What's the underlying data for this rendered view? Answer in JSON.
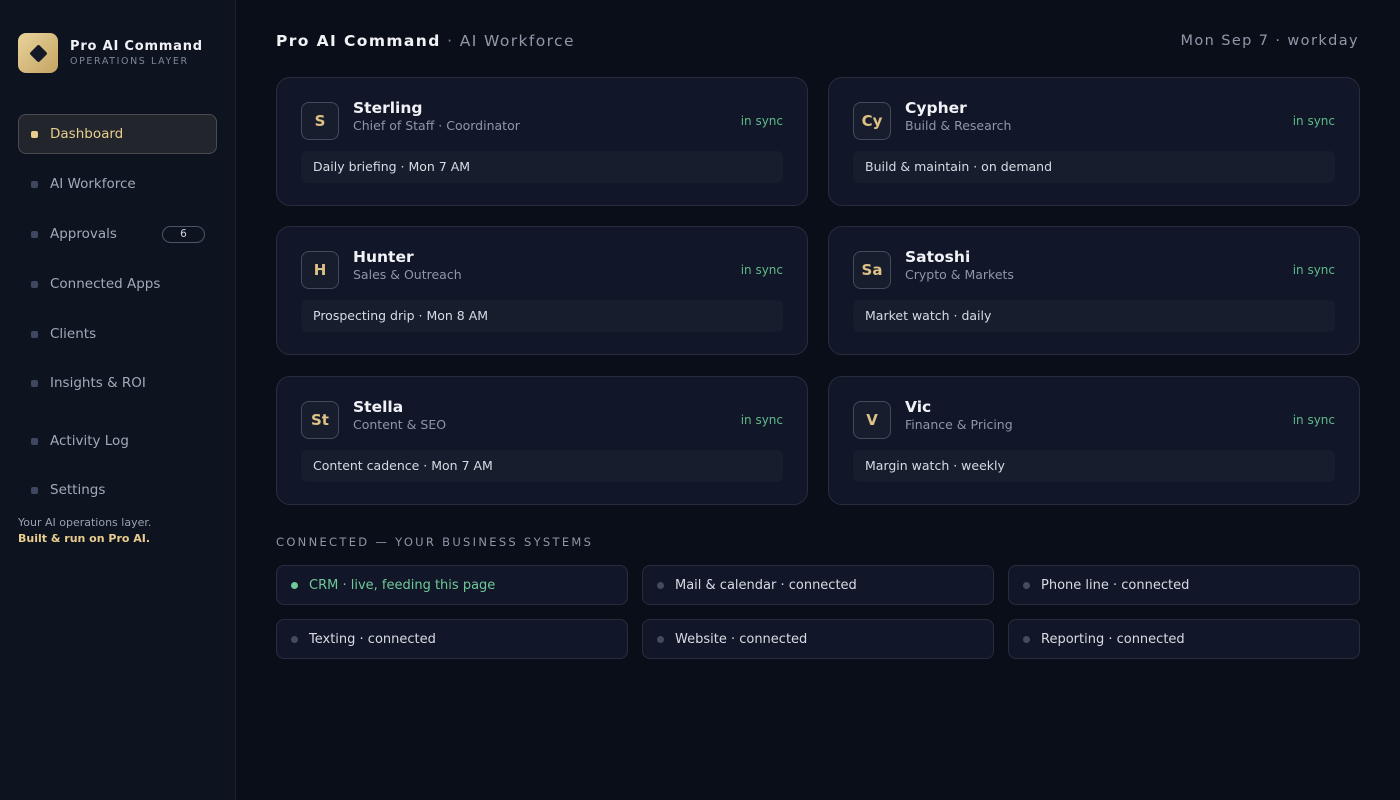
{
  "brand": {
    "title": "Pro AI Command",
    "subtitle": "OPERATIONS LAYER"
  },
  "nav": [
    {
      "label": "Dashboard",
      "active": true
    },
    {
      "label": "AI Workforce"
    },
    {
      "label": "Approvals",
      "badge": "6"
    },
    {
      "label": "Connected Apps"
    },
    {
      "label": "Clients"
    },
    {
      "label": "Insights & ROI"
    },
    {
      "label": "Activity Log"
    },
    {
      "label": "Settings"
    }
  ],
  "sidebar_footer": {
    "line1": "Your AI operations layer.",
    "line2": "Built & run on Pro AI."
  },
  "header": {
    "title": "Pro AI Command",
    "separator": "·",
    "subtitle": "AI Workforce",
    "date": "Mon Sep 7 · workday"
  },
  "agents": [
    {
      "initials": "S",
      "name": "Sterling",
      "role": "Chief of Staff · Coordinator",
      "status": "in sync",
      "task": "Daily briefing · Mon 7 AM"
    },
    {
      "initials": "Cy",
      "name": "Cypher",
      "role": "Build & Research",
      "status": "in sync",
      "task": "Build & maintain · on demand"
    },
    {
      "initials": "H",
      "name": "Hunter",
      "role": "Sales & Outreach",
      "status": "in sync",
      "task": "Prospecting drip · Mon 8 AM"
    },
    {
      "initials": "Sa",
      "name": "Satoshi",
      "role": "Crypto & Markets",
      "status": "in sync",
      "task": "Market watch · daily"
    },
    {
      "initials": "St",
      "name": "Stella",
      "role": "Content & SEO",
      "status": "in sync",
      "task": "Content cadence · Mon 7 AM"
    },
    {
      "initials": "V",
      "name": "Vic",
      "role": "Finance & Pricing",
      "status": "in sync",
      "task": "Margin watch · weekly"
    }
  ],
  "connected": {
    "label": "CONNECTED — YOUR BUSINESS SYSTEMS",
    "items": [
      {
        "label": "CRM · live, feeding this page",
        "live": true
      },
      {
        "label": "Mail & calendar · connected"
      },
      {
        "label": "Phone line · connected"
      },
      {
        "label": "Texting · connected"
      },
      {
        "label": "Website · connected"
      },
      {
        "label": "Reporting · connected"
      }
    ]
  },
  "colors": {
    "accent": "#e8cd8e",
    "sync_green": "#5fb98a",
    "background": "#0a0e18",
    "card": "#111728"
  }
}
